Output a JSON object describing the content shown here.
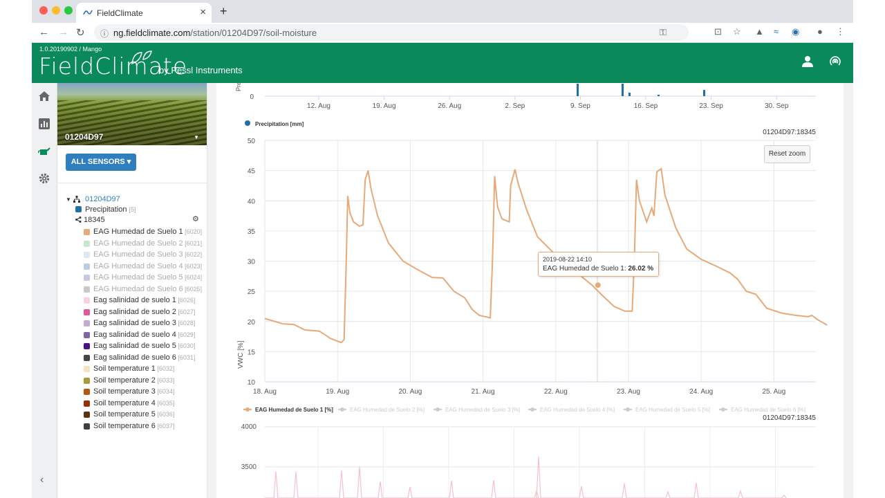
{
  "browser": {
    "tab_title": "FieldClimate",
    "url_host": "ng.fieldclimate.com",
    "url_path": "/station/01204D97/soil-moisture"
  },
  "app": {
    "version": "1.0.20190902 / Mango",
    "logo": "FieldClimate",
    "byline": "by Pessl Instruments"
  },
  "sidebar": {
    "station_name": "01204D97",
    "sensors_button": "ALL SENSORS",
    "tree_root": "01204D97",
    "precip_label": "Precipitation",
    "precip_code": "[5]",
    "node_label": "18345",
    "sensors": [
      {
        "label": "EAG Humedad de Suelo 1",
        "code": "[6020]",
        "color": "#e8a978",
        "active": true
      },
      {
        "label": "EAG Humedad de Suelo 2",
        "code": "[6021]",
        "color": "#c9e8c9",
        "active": false
      },
      {
        "label": "EAG Humedad de Suelo 3",
        "code": "[6022]",
        "color": "#dfe7f1",
        "active": false
      },
      {
        "label": "EAG Humedad de Suelo 4",
        "code": "[6023]",
        "color": "#b7cde2",
        "active": false
      },
      {
        "label": "EAG Humedad de Suelo 5",
        "code": "[6024]",
        "color": "#c8c8e4",
        "active": false
      },
      {
        "label": "EAG Humedad de Suelo 6",
        "code": "[6025]",
        "color": "#c9c9c9",
        "active": false
      },
      {
        "label": "Eag salinidad de suelo 1",
        "code": "[6026]",
        "color": "#f8d3dc",
        "active": true
      },
      {
        "label": "Eag salinidad de suelo 2",
        "code": "[6027]",
        "color": "#e1579b",
        "active": true
      },
      {
        "label": "Eag salinidad de suelo 3",
        "code": "[6028]",
        "color": "#c5a8d4",
        "active": true
      },
      {
        "label": "Eag salinidad de suelo 4",
        "code": "[6029]",
        "color": "#8064a8",
        "active": true
      },
      {
        "label": "Eag salinidad de suelo 5",
        "code": "[6030]",
        "color": "#4a1583",
        "active": true
      },
      {
        "label": "Eag salinidad de suelo 6",
        "code": "[6031]",
        "color": "#444444",
        "active": true
      },
      {
        "label": "Soil temperature 1",
        "code": "[6032]",
        "color": "#f3e3c0",
        "active": true
      },
      {
        "label": "Soil temperature 2",
        "code": "[6033]",
        "color": "#a89a3e",
        "active": true
      },
      {
        "label": "Soil temperature 3",
        "code": "[6034]",
        "color": "#b35a10",
        "active": true
      },
      {
        "label": "Soil temperature 4",
        "code": "[6035]",
        "color": "#9a2e06",
        "active": true
      },
      {
        "label": "Soil temperature 5",
        "code": "[6036]",
        "color": "#5a3410",
        "active": true
      },
      {
        "label": "Soil temperature 6",
        "code": "[6037]",
        "color": "#3e3e3e",
        "active": true
      }
    ]
  },
  "main": {
    "reset_zoom": "Reset zoom",
    "tooltip_date": "2019-08-22 14:10",
    "tooltip_series": "EAG Humedad de Suelo 1:",
    "tooltip_value": "26.02 %"
  },
  "chart_data": [
    {
      "type": "bar",
      "ylabel": "Prec",
      "x_ticks": [
        "12. Aug",
        "19. Aug",
        "26. Aug",
        "2. Sep",
        "9. Sep",
        "16. Sep",
        "23. Sep",
        "30. Sep"
      ],
      "y_ticks": [
        "0"
      ],
      "legend": [
        "Precipitation [mm]"
      ],
      "colors": [
        "#1f6fa8"
      ]
    },
    {
      "type": "line",
      "ylabel": "VWC [%]",
      "ylim": [
        10,
        50
      ],
      "y_ticks": [
        10,
        15,
        20,
        25,
        30,
        35,
        40,
        45,
        50
      ],
      "x_ticks": [
        "18. Aug",
        "19. Aug",
        "20. Aug",
        "21. Aug",
        "22. Aug",
        "23. Aug",
        "24. Aug",
        "25. Aug"
      ],
      "id_label": "01204D97:18345",
      "grid": true,
      "series": [
        {
          "name": "EAG Humedad de Suelo 1 [%]",
          "color": "#e8a978",
          "points": [
            [
              0.0,
              20.5
            ],
            [
              0.25,
              19.6
            ],
            [
              0.4,
              19.5
            ],
            [
              0.55,
              18.6
            ],
            [
              0.75,
              18.4
            ],
            [
              0.9,
              17.2
            ],
            [
              1.05,
              16.5
            ],
            [
              1.09,
              17.0
            ],
            [
              1.12,
              30
            ],
            [
              1.14,
              40.8
            ],
            [
              1.17,
              38
            ],
            [
              1.22,
              36.5
            ],
            [
              1.3,
              35.8
            ],
            [
              1.35,
              36.0
            ],
            [
              1.38,
              43.5
            ],
            [
              1.42,
              45.0
            ],
            [
              1.46,
              42
            ],
            [
              1.55,
              37.5
            ],
            [
              1.7,
              33.0
            ],
            [
              1.9,
              30.0
            ],
            [
              2.1,
              28.6
            ],
            [
              2.3,
              27.3
            ],
            [
              2.45,
              27.2
            ],
            [
              2.6,
              25.0
            ],
            [
              2.75,
              23.9
            ],
            [
              2.85,
              22.0
            ],
            [
              2.95,
              21.0
            ],
            [
              3.1,
              20.6
            ],
            [
              3.13,
              30
            ],
            [
              3.16,
              44.1
            ],
            [
              3.2,
              39
            ],
            [
              3.26,
              37.0
            ],
            [
              3.36,
              36.5
            ],
            [
              3.38,
              42.5
            ],
            [
              3.44,
              45.2
            ],
            [
              3.48,
              43
            ],
            [
              3.6,
              38.5
            ],
            [
              3.75,
              34.0
            ],
            [
              4.0,
              31.0
            ],
            [
              4.25,
              28.5
            ],
            [
              4.5,
              26.0
            ],
            [
              4.65,
              24.2
            ],
            [
              4.8,
              22.5
            ],
            [
              4.95,
              21.7
            ],
            [
              5.05,
              21.7
            ],
            [
              5.08,
              30
            ],
            [
              5.11,
              43.5
            ],
            [
              5.15,
              40
            ],
            [
              5.25,
              36.5
            ],
            [
              5.32,
              38.8
            ],
            [
              5.35,
              37.5
            ],
            [
              5.39,
              44.8
            ],
            [
              5.45,
              45.3
            ],
            [
              5.5,
              41
            ],
            [
              5.65,
              35.5
            ],
            [
              5.8,
              32.0
            ],
            [
              6.0,
              30.3
            ],
            [
              6.2,
              29.2
            ],
            [
              6.4,
              28.0
            ],
            [
              6.5,
              27.0
            ],
            [
              6.62,
              25.0
            ],
            [
              6.75,
              24.5
            ],
            [
              6.9,
              22.2
            ],
            [
              7.1,
              21.4
            ],
            [
              7.3,
              21.0
            ],
            [
              7.47,
              20.8
            ],
            [
              7.52,
              21.0
            ],
            [
              7.6,
              20.3
            ],
            [
              7.6,
              20.3
            ],
            [
              7.73,
              19.4
            ]
          ]
        }
      ],
      "legend": [
        "EAG Humedad de Suelo 1 [%]",
        "EAG Humedad de Suelo 2 [%]",
        "EAG Humedad de Suelo 3 [%]",
        "EAG Humedad de Suelo 4 [%]",
        "EAG Humedad de Suelo 5 [%]",
        "EAG Humedad de Suelo 6 [%]"
      ],
      "legend_placement": "bottom"
    },
    {
      "type": "line",
      "y_ticks": [
        3500,
        4000
      ],
      "id_label": "01204D97:18345"
    }
  ]
}
